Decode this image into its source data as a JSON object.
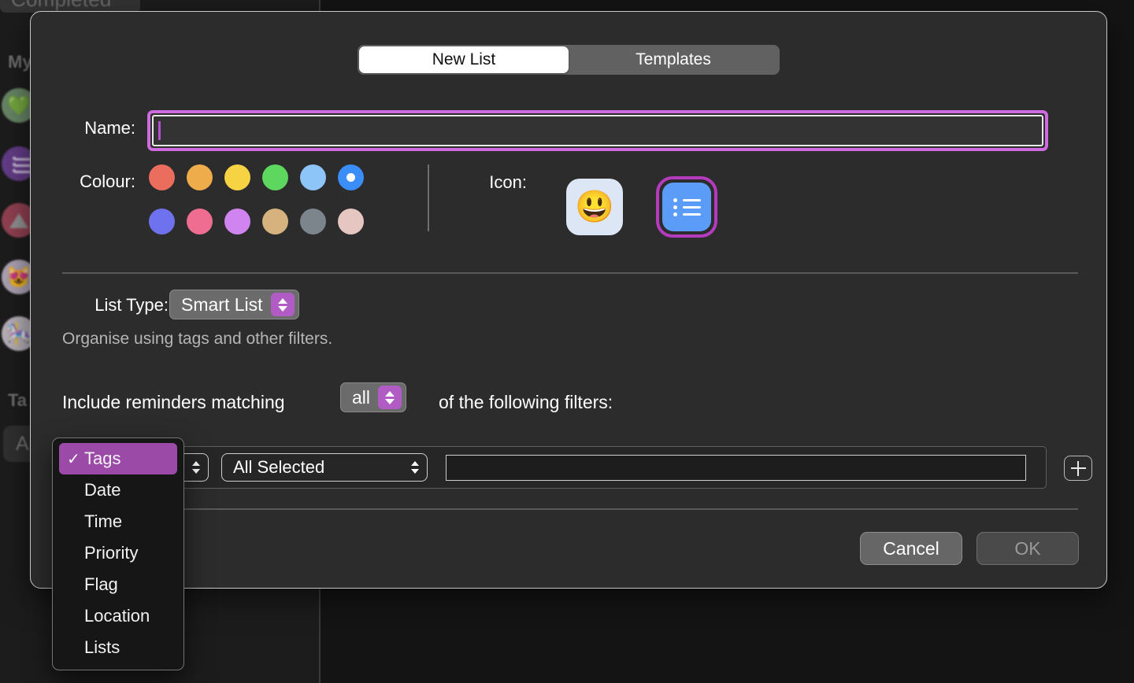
{
  "background": {
    "completed_label": "Completed",
    "my_lists_label": "My",
    "tags_label": "Ta",
    "tag_pill_label": "A",
    "list_icons": [
      "green-heart",
      "purple-list",
      "red-triangle",
      "cat-heart-eyes",
      "carousel-horse"
    ]
  },
  "dialog": {
    "tabs": [
      {
        "label": "New List",
        "selected": true
      },
      {
        "label": "Templates",
        "selected": false
      }
    ],
    "name": {
      "label": "Name:",
      "value": "",
      "placeholder": ""
    },
    "colour": {
      "label": "Colour:",
      "selected_index": 5,
      "swatches": [
        "#ea6d5e",
        "#eeac4b",
        "#f5d343",
        "#5ed75e",
        "#8ec5f8",
        "#3b8df7",
        "#6f72ee",
        "#ef6d91",
        "#cf84f0",
        "#d6b37e",
        "#7c848c",
        "#e6c6c0"
      ]
    },
    "icon": {
      "label": "Icon:",
      "options": [
        {
          "name": "emoji-smiley-icon",
          "glyph": "😃",
          "selected": false
        },
        {
          "name": "bulleted-list-icon",
          "glyph": "list",
          "selected": true
        }
      ]
    },
    "list_type": {
      "label": "List Type:",
      "value": "Smart List",
      "helper": "Organise using tags and other filters."
    },
    "filters": {
      "sentence_prefix": "Include reminders matching",
      "match_value": "all",
      "sentence_suffix": "of the following filters:",
      "row": {
        "criterion_value": "Tags",
        "selection_value": "All Selected",
        "text_value": "",
        "add_button_label": "+"
      }
    },
    "menu": {
      "items": [
        {
          "label": "Tags",
          "checked": true
        },
        {
          "label": "Date",
          "checked": false
        },
        {
          "label": "Time",
          "checked": false
        },
        {
          "label": "Priority",
          "checked": false
        },
        {
          "label": "Flag",
          "checked": false
        },
        {
          "label": "Location",
          "checked": false
        },
        {
          "label": "Lists",
          "checked": false
        }
      ],
      "check_glyph": "✓"
    },
    "actions": {
      "cancel_label": "Cancel",
      "ok_label": "OK",
      "ok_disabled": true
    }
  },
  "colors": {
    "accent_purple": "#9b4aa8",
    "focus_ring": "#cf6ae0",
    "selected_blue": "#3b8df7",
    "dialog_bg": "#2c2c2c"
  }
}
